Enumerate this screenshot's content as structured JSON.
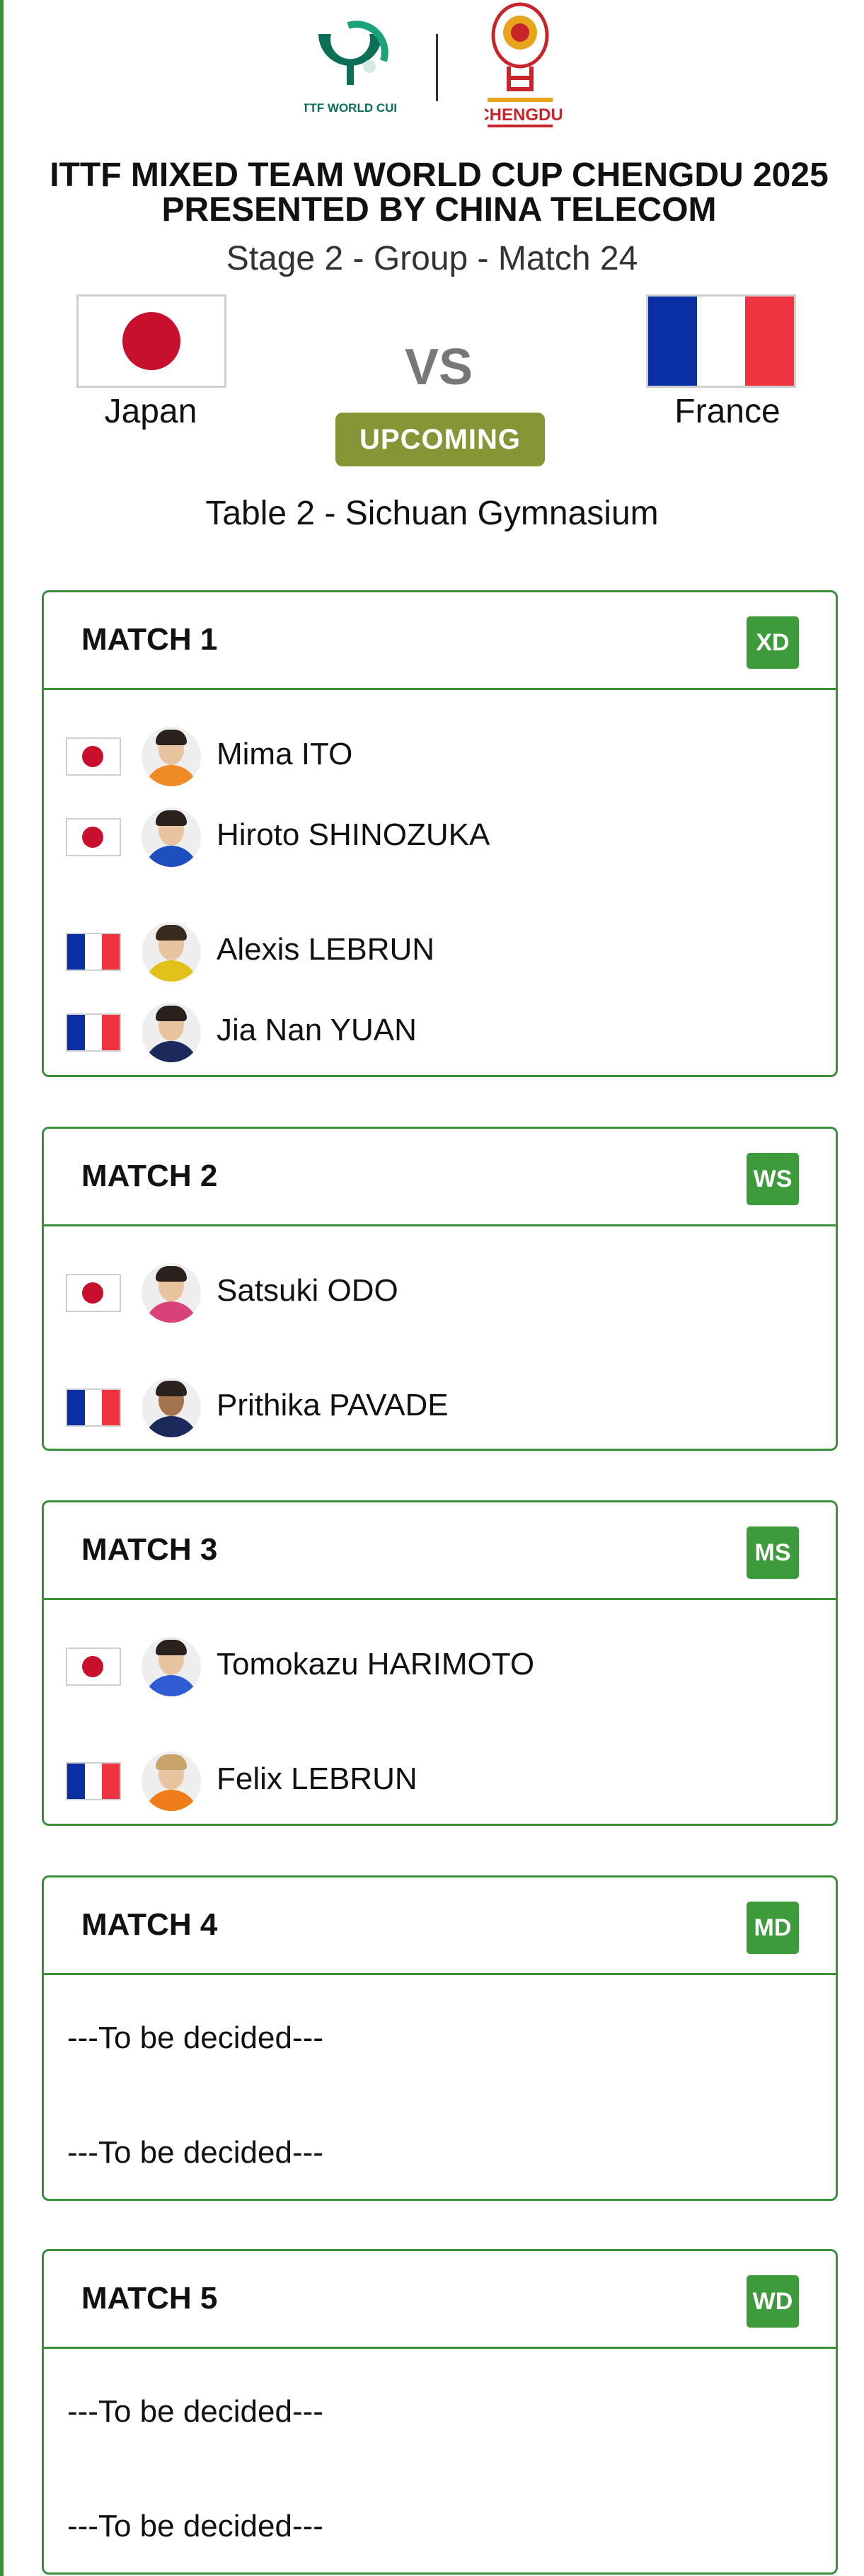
{
  "event": {
    "logo_ittf_text": "ITTF WORLD CUP",
    "logo_chengdu_text": "CHENGDU",
    "title_line1": "ITTF MIXED TEAM WORLD CUP CHENGDU 2025",
    "title_line2": "PRESENTED BY CHINA TELECOM",
    "stage": "Stage 2 - Group - Match 24"
  },
  "teams": {
    "home": "Japan",
    "away": "France",
    "vs_label": "VS",
    "status": "UPCOMING",
    "venue": "Table 2 - Sichuan Gymnasium"
  },
  "colors": {
    "accent_green": "#3b8f3a",
    "status_olive": "#879537",
    "japan_red": "#c8102e",
    "france_blue": "#0a2ea4",
    "france_red": "#ef3340"
  },
  "matches": [
    {
      "title": "MATCH 1",
      "type": "XD",
      "home_players": [
        "Mima ITO",
        "Hiroto SHINOZUKA"
      ],
      "away_players": [
        "Alexis LEBRUN",
        "Jia Nan YUAN"
      ]
    },
    {
      "title": "MATCH 2",
      "type": "WS",
      "home_players": [
        "Satsuki ODO"
      ],
      "away_players": [
        "Prithika PAVADE"
      ]
    },
    {
      "title": "MATCH 3",
      "type": "MS",
      "home_players": [
        "Tomokazu HARIMOTO"
      ],
      "away_players": [
        "Felix LEBRUN"
      ]
    },
    {
      "title": "MATCH 4",
      "type": "MD",
      "home_tbd": "---To be decided---",
      "away_tbd": "---To be decided---"
    },
    {
      "title": "MATCH 5",
      "type": "WD",
      "home_tbd": "---To be decided---",
      "away_tbd": "---To be decided---"
    }
  ]
}
